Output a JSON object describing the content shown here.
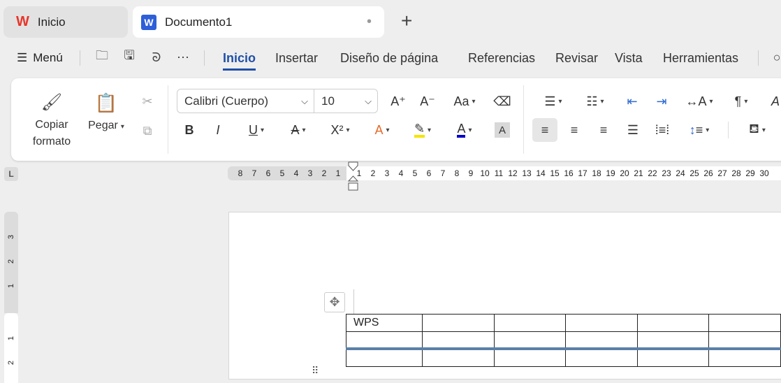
{
  "tabs": [
    {
      "label": "Inicio",
      "icon": "wps-logo-icon"
    },
    {
      "label": "Documento1",
      "icon": "wps-writer-icon",
      "status": "•"
    }
  ],
  "new_tab": "+",
  "menubar": {
    "menu_label": "Menú",
    "tabs": [
      "Inicio",
      "Insertar",
      "Diseño de página",
      "Referencias",
      "Revisar",
      "Vista",
      "Herramientas"
    ],
    "active": "Inicio"
  },
  "ribbon": {
    "copy_format": "Copiar formato",
    "paste": "Pegar",
    "font_name": "Calibri (Cuerpo)",
    "font_size": "10",
    "bold": "B",
    "italic": "I",
    "underline": "U",
    "strike": "A",
    "superscript": "X²",
    "text_effect": "A",
    "highlight": "A",
    "font_color": "A",
    "char_shading": "A",
    "grow": "A⁺",
    "shrink": "A⁻",
    "change_case": "Aa",
    "para": "¶",
    "sort": "A"
  },
  "colors": {
    "accent": "#1f4fa8",
    "highlight": "#f5e400",
    "font_color": "#0000c8",
    "table_blue": "#5b7fa8"
  },
  "ruler": {
    "left": [
      "8",
      "7",
      "6",
      "5",
      "4",
      "3",
      "2",
      "1"
    ],
    "right": [
      "1",
      "2",
      "3",
      "4",
      "5",
      "6",
      "7",
      "8",
      "9",
      "10",
      "11",
      "12",
      "13",
      "14",
      "15",
      "16",
      "17",
      "18",
      "19",
      "20",
      "21",
      "22",
      "23",
      "24",
      "25",
      "26",
      "27",
      "28",
      "29",
      "30"
    ],
    "vertical_top": [
      "3",
      "2",
      "1"
    ],
    "vertical_bottom": [
      "1",
      "2"
    ]
  },
  "table": {
    "rows": [
      [
        "WPS",
        "",
        "",
        "",
        "",
        ""
      ],
      [
        "",
        "",
        "",
        "",
        "",
        ""
      ],
      [
        "",
        "",
        "",
        "",
        "",
        ""
      ]
    ]
  }
}
